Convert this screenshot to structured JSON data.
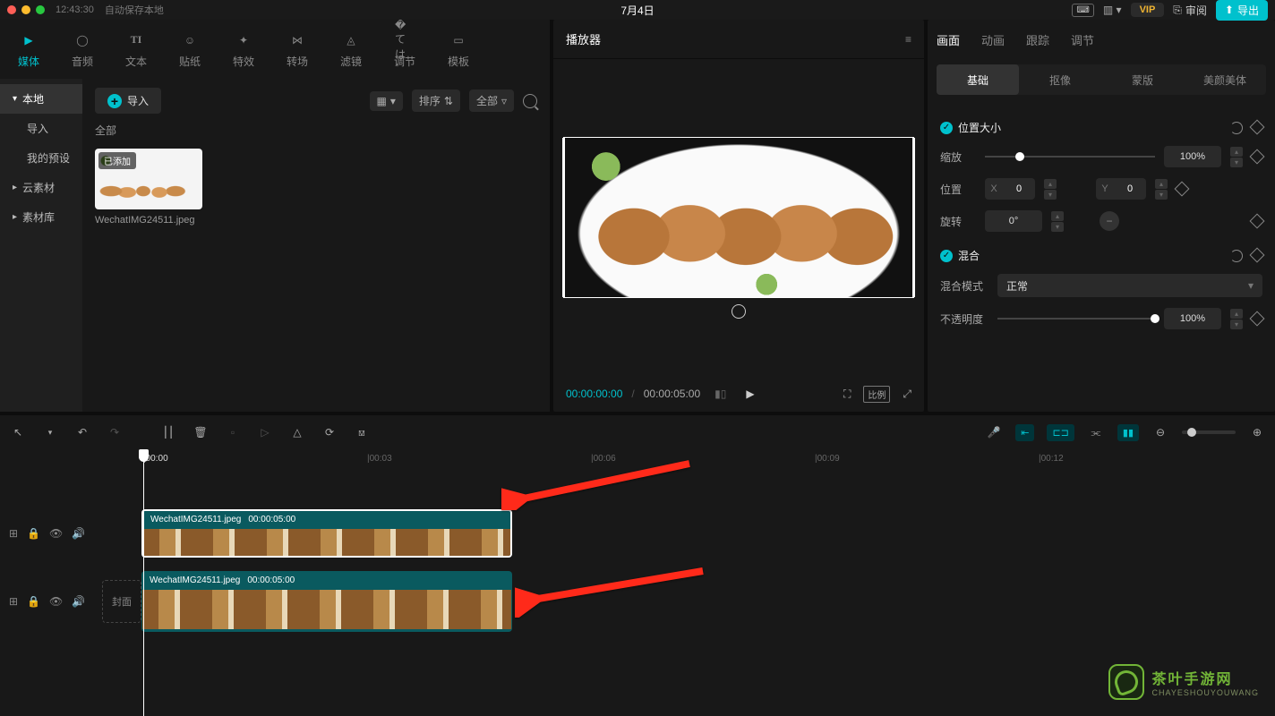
{
  "titlebar": {
    "time": "12:43:30",
    "autosave": "自动保存本地",
    "project_title": "7月4日",
    "vip": "VIP",
    "review": "审阅",
    "export": "导出"
  },
  "tool_tabs": [
    "媒体",
    "音频",
    "文本",
    "贴纸",
    "特效",
    "转场",
    "滤镜",
    "调节",
    "模板"
  ],
  "media_side": {
    "local": "本地",
    "import": "导入",
    "presets": "我的预设",
    "cloud": "云素材",
    "library": "素材库"
  },
  "media": {
    "import_btn": "导入",
    "filters": {
      "sort": "排序",
      "all": "全部"
    },
    "all_label": "全部",
    "thumb": {
      "added": "已添加",
      "name": "WechatIMG24511.jpeg"
    }
  },
  "preview": {
    "title": "播放器",
    "time_current": "00:00:00:00",
    "time_total": "00:00:05:00",
    "ratio": "比例"
  },
  "props": {
    "tabs": [
      "画面",
      "动画",
      "跟踪",
      "调节"
    ],
    "subtabs": [
      "基础",
      "抠像",
      "蒙版",
      "美颜美体"
    ],
    "section_pos": "位置大小",
    "scale_label": "缩放",
    "scale_value": "100%",
    "pos_label": "位置",
    "pos_x": "0",
    "pos_y": "0",
    "rotate_label": "旋转",
    "rotate_value": "0°",
    "section_blend": "混合",
    "blend_mode_label": "混合模式",
    "blend_mode_value": "正常",
    "opacity_label": "不透明度",
    "opacity_value": "100%"
  },
  "ruler": [
    "00:00",
    "00:03",
    "00:06",
    "00:09",
    "00:12"
  ],
  "track": {
    "cover": "封面",
    "clip_name": "WechatIMG24511.jpeg",
    "clip_dur": "00:00:05:00"
  },
  "watermark": {
    "title": "茶叶手游网",
    "sub": "CHAYESHOUYOUWANG"
  }
}
